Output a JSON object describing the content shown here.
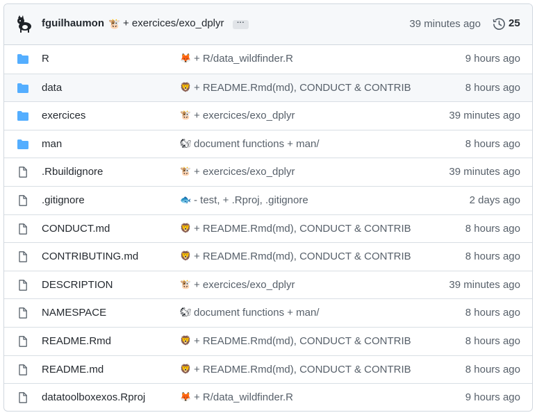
{
  "latest_commit": {
    "author": "fguilhaumon",
    "emoji": "🐮",
    "message": "+ exercices/exo_dplyr",
    "ellipsis": "···",
    "time": "39 minutes ago",
    "history_count": "25"
  },
  "colors": {
    "folder": "#54aeff",
    "file": "#57606a",
    "muted": "#57606a",
    "border": "#d0d7de"
  },
  "files": [
    {
      "type": "dir",
      "name": "R",
      "emoji": "🦊",
      "message": "+ R/data_wildfinder.R",
      "time": "9 hours ago"
    },
    {
      "type": "dir",
      "name": "data",
      "emoji": "🦁",
      "message": "+ README.Rmd(md), CONDUCT & CONTRIB",
      "time": "8 hours ago"
    },
    {
      "type": "dir",
      "name": "exercices",
      "emoji": "🐮",
      "message": "+ exercices/exo_dplyr",
      "time": "39 minutes ago"
    },
    {
      "type": "dir",
      "name": "man",
      "emoji": "🐿",
      "message": "document functions + man/",
      "time": "8 hours ago"
    },
    {
      "type": "file",
      "name": ".Rbuildignore",
      "emoji": "🐮",
      "message": "+ exercices/exo_dplyr",
      "time": "39 minutes ago"
    },
    {
      "type": "file",
      "name": ".gitignore",
      "emoji": "🐟",
      "message": "- test, + .Rproj, .gitignore",
      "time": "2 days ago"
    },
    {
      "type": "file",
      "name": "CONDUCT.md",
      "emoji": "🦁",
      "message": "+ README.Rmd(md), CONDUCT & CONTRIB",
      "time": "8 hours ago"
    },
    {
      "type": "file",
      "name": "CONTRIBUTING.md",
      "emoji": "🦁",
      "message": "+ README.Rmd(md), CONDUCT & CONTRIB",
      "time": "8 hours ago"
    },
    {
      "type": "file",
      "name": "DESCRIPTION",
      "emoji": "🐮",
      "message": "+ exercices/exo_dplyr",
      "time": "39 minutes ago"
    },
    {
      "type": "file",
      "name": "NAMESPACE",
      "emoji": "🐿",
      "message": "document functions + man/",
      "time": "8 hours ago"
    },
    {
      "type": "file",
      "name": "README.Rmd",
      "emoji": "🦁",
      "message": "+ README.Rmd(md), CONDUCT & CONTRIB",
      "time": "8 hours ago"
    },
    {
      "type": "file",
      "name": "README.md",
      "emoji": "🦁",
      "message": "+ README.Rmd(md), CONDUCT & CONTRIB",
      "time": "8 hours ago"
    },
    {
      "type": "file",
      "name": "datatoolboxexos.Rproj",
      "emoji": "🦊",
      "message": "+ R/data_wildfinder.R",
      "time": "9 hours ago"
    }
  ]
}
